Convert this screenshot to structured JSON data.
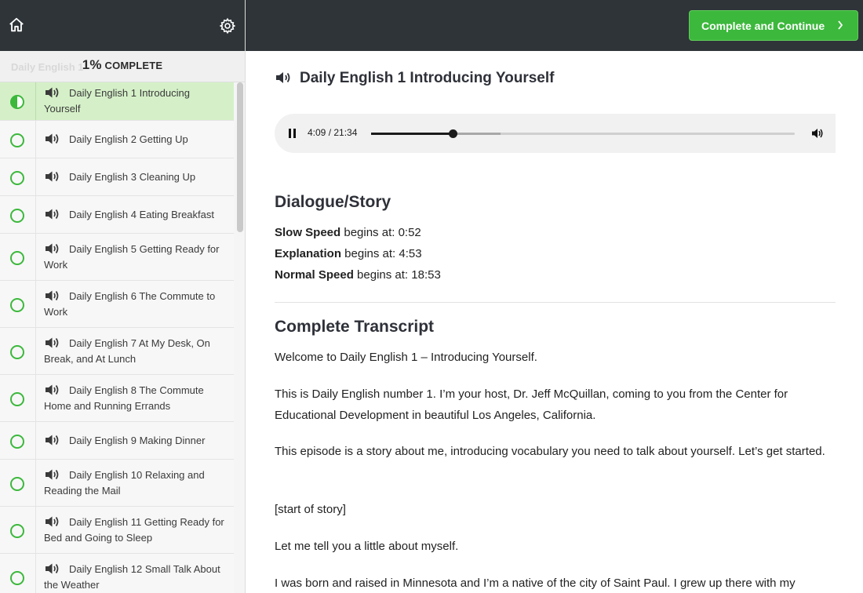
{
  "sidebar": {
    "progress_percent": "1%",
    "progress_label": "COMPLETE",
    "progress_ghost": "Daily English 1",
    "lessons": [
      {
        "title": "Daily English 1 Introducing Yourself",
        "status": "in-progress",
        "active": true
      },
      {
        "title": "Daily English 2 Getting Up",
        "status": "not-started"
      },
      {
        "title": "Daily English 3 Cleaning Up",
        "status": "not-started"
      },
      {
        "title": "Daily English 4 Eating Breakfast",
        "status": "not-started"
      },
      {
        "title": "Daily English 5 Getting Ready for Work",
        "status": "not-started"
      },
      {
        "title": "Daily English 6 The Commute to Work",
        "status": "not-started"
      },
      {
        "title": "Daily English 7 At My Desk, On Break, and At Lunch",
        "status": "not-started"
      },
      {
        "title": "Daily English 8 The Commute Home and Running Errands",
        "status": "not-started"
      },
      {
        "title": "Daily English 9 Making Dinner",
        "status": "not-started"
      },
      {
        "title": "Daily English 10 Relaxing and Reading the Mail",
        "status": "not-started"
      },
      {
        "title": "Daily English 11 Getting Ready for Bed and Going to Sleep",
        "status": "not-started"
      },
      {
        "title": "Daily English 12 Small Talk About the Weather",
        "status": "not-started"
      }
    ]
  },
  "topbar": {
    "cta_label": "Complete and Continue"
  },
  "lecture": {
    "title": "Daily English 1 Introducing Yourself"
  },
  "player": {
    "time_display": "4:09 / 21:34",
    "progress_fraction": 0.1924,
    "buffered_fraction": 0.306
  },
  "dialogue": {
    "heading": "Dialogue/Story",
    "items": [
      {
        "label": "Slow Speed",
        "text": " begins at: 0:52"
      },
      {
        "label": "Explanation",
        "text": " begins at: 4:53"
      },
      {
        "label": "Normal Speed",
        "text": " begins at: 18:53"
      }
    ]
  },
  "transcript": {
    "heading": "Complete Transcript",
    "paragraphs": [
      "Welcome to Daily English 1 – Introducing Yourself.",
      "This is Daily English number 1. I’m your host, Dr. Jeff McQuillan, coming to you from the Center for Educational Development in beautiful Los Angeles, California.",
      "This episode is a story about me, introducing vocabulary you need to talk about yourself. Let’s get started.",
      "[start of story]",
      "Let me tell you a little about myself.",
      "I was born and raised in Minnesota and I’m a native of the city of Saint Paul. I grew up there with my"
    ]
  },
  "colors": {
    "topbar": "#2e3438",
    "accent_green": "#3cb83c",
    "active_lesson_bg": "#d5f0c8"
  }
}
